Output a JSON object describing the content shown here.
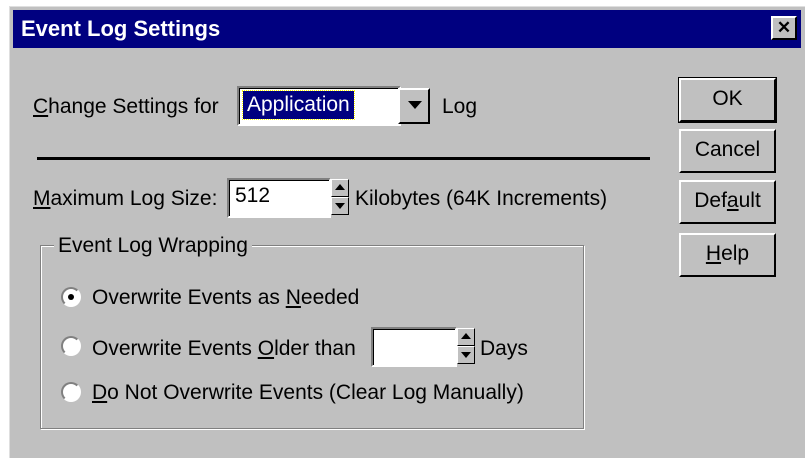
{
  "window": {
    "title": "Event Log Settings",
    "close_glyph": "✕"
  },
  "change_settings": {
    "prefix_underlined": "C",
    "prefix_rest": "hange Settings for",
    "selected_log": "Application",
    "suffix": "Log"
  },
  "max_size": {
    "label_underlined": "M",
    "label_rest": "aximum Log Size:",
    "value": "512",
    "units": "Kilobytes  (64K Increments)"
  },
  "wrapping": {
    "group_label": "Event Log Wrapping",
    "options": [
      {
        "before": "Overwrite Events as ",
        "underlined": "N",
        "after": "eeded",
        "selected": true
      },
      {
        "before": "Overwrite Events ",
        "underlined": "O",
        "after": "lder than",
        "selected": false
      },
      {
        "before": "",
        "underlined": "D",
        "after": "o Not Overwrite Events (Clear Log Manually)",
        "selected": false
      }
    ],
    "days_value": "",
    "days_label": "Days"
  },
  "buttons": {
    "ok": "OK",
    "cancel": "Cancel",
    "default_before": "Def",
    "default_underlined": "a",
    "default_after": "ult",
    "help_underlined": "H",
    "help_after": "elp"
  }
}
